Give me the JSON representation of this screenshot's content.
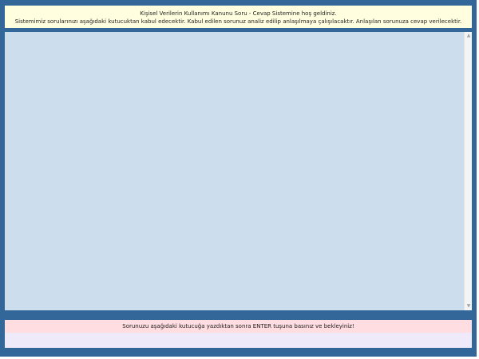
{
  "welcome": {
    "line1": "Kişisel Verilerin Kullanımı Kanunu Soru - Cevap Sistemine hoş geldiniz.",
    "line2": "Sistemimiz sorularınızı aşağıdaki kutucuktan kabul edecektir. Kabul edilen sorunuz analiz edilip anlaşılmaya çalışılacaktır. Anlaşılan sorunuza cevap verilecektir."
  },
  "instruction": {
    "text": "Sorunuzu aşağıdaki kutucuğa yazdıktan sonra ENTER tuşuna basınız ve bekleyiniz!"
  },
  "input": {
    "value": "",
    "placeholder": ""
  },
  "scrollbar": {
    "up_icon": "▲",
    "down_icon": "▼"
  },
  "colors": {
    "frame": "#336699",
    "welcome_bg": "#ffffe0",
    "chat_bg": "#ccdded",
    "instruction_bg": "#ffdde1",
    "input_bg": "#efeafa"
  }
}
